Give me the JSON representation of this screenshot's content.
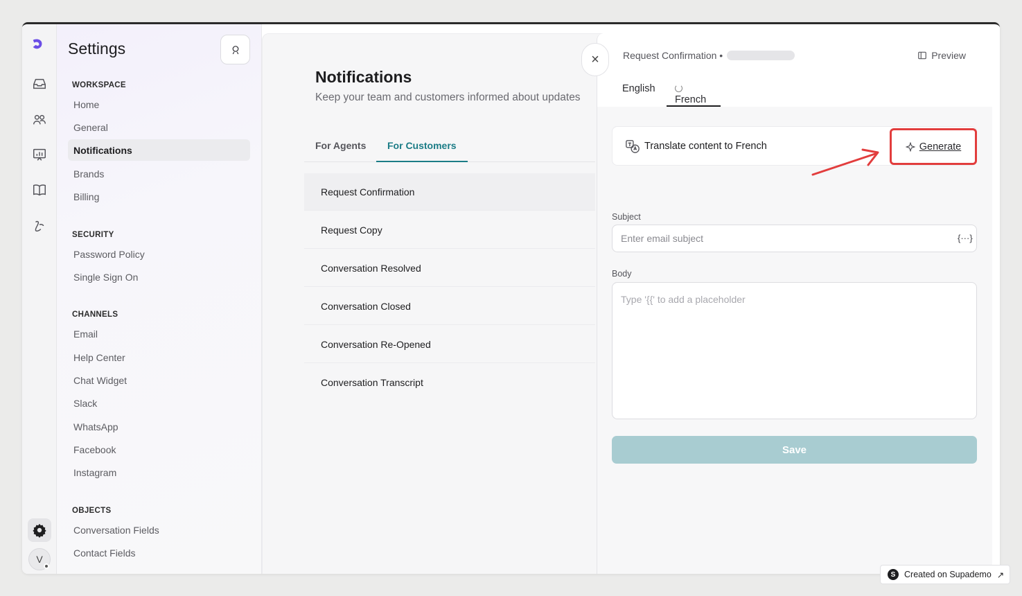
{
  "sidebar": {
    "title": "Settings",
    "sections": [
      {
        "label": "WORKSPACE",
        "items": [
          "Home",
          "General",
          "Notifications",
          "Brands",
          "Billing"
        ]
      },
      {
        "label": "SECURITY",
        "items": [
          "Password Policy",
          "Single Sign On"
        ]
      },
      {
        "label": "CHANNELS",
        "items": [
          "Email",
          "Help Center",
          "Chat Widget",
          "Slack",
          "WhatsApp",
          "Facebook",
          "Instagram"
        ]
      },
      {
        "label": "OBJECTS",
        "items": [
          "Conversation Fields",
          "Contact Fields"
        ]
      }
    ],
    "active_item": "Notifications",
    "avatar_initial": "V"
  },
  "notifications": {
    "title": "Notifications",
    "subtitle": "Keep your team and customers informed about updates",
    "tabs": [
      "For Agents",
      "For Customers"
    ],
    "active_tab": "For Customers",
    "rows": [
      "Request Confirmation",
      "Request Copy",
      "Conversation Resolved",
      "Conversation Closed",
      "Conversation Re-Opened",
      "Conversation Transcript"
    ]
  },
  "drawer": {
    "breadcrumb": "Request Confirmation •",
    "preview_label": "Preview",
    "languages": [
      "English",
      "French"
    ],
    "active_language": "French",
    "translate_label": "Translate content to French",
    "generate_label": "Generate",
    "subject_label": "Subject",
    "subject_placeholder": "Enter email subject",
    "placeholder_button": "{···}",
    "body_label": "Body",
    "body_placeholder": "Type '{{' to add a placeholder",
    "save_label": "Save"
  },
  "badge": {
    "label": "Created on Supademo"
  },
  "colors": {
    "accent": "#1b7c86",
    "save_disabled": "#a8ccd1",
    "highlight": "#e23d3d"
  }
}
